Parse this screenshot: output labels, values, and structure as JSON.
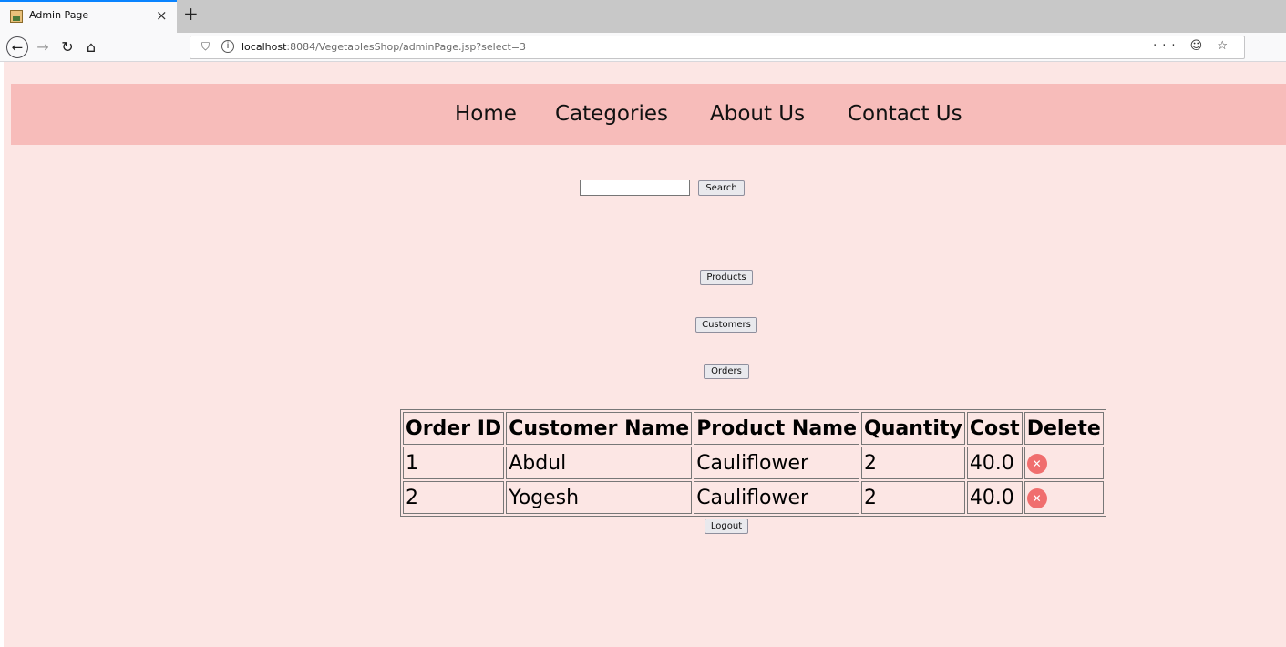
{
  "browser": {
    "tab_title": "Admin Page",
    "tab_close": "×",
    "new_tab": "+",
    "url_host": "localhost",
    "url_rest": ":8084/VegetablesShop/adminPage.jsp?select=3",
    "url_actions": "··· ☺ ☆"
  },
  "nav": {
    "home": "Home",
    "categories": "Categories",
    "about": "About Us",
    "contact": "Contact Us"
  },
  "search": {
    "value": "",
    "placeholder": "",
    "button_label": "Search"
  },
  "admin_buttons": {
    "products": "Products",
    "customers": "Customers",
    "orders": "Orders",
    "logout": "Logout"
  },
  "orders_table": {
    "headers": {
      "order_id": "Order ID",
      "customer_name": "Customer Name",
      "product_name": "Product Name",
      "quantity": "Quantity",
      "cost": "Cost",
      "delete": "Delete"
    },
    "rows": [
      {
        "order_id": "1",
        "customer_name": "Abdul",
        "product_name": "Cauliflower",
        "quantity": "2",
        "cost": "40.0"
      },
      {
        "order_id": "2",
        "customer_name": "Yogesh",
        "product_name": "Cauliflower",
        "quantity": "2",
        "cost": "40.0"
      }
    ]
  },
  "icons": {
    "delete": "delete-circle-icon",
    "delete_glyph": "✕",
    "delete_color": "#f06e6e"
  },
  "colors": {
    "page_background": "#fce6e4",
    "nav_background": "#f7bcba"
  }
}
